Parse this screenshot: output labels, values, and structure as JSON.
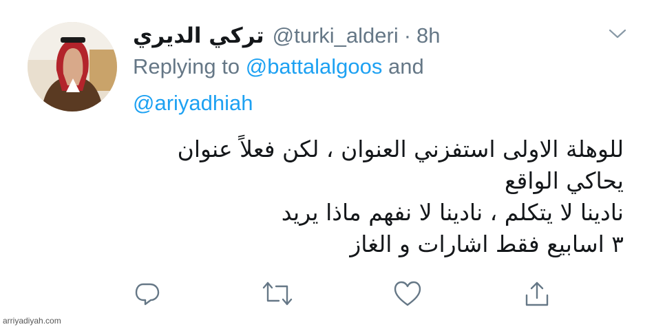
{
  "tweet": {
    "display_name": "تركي الديري",
    "handle": "@turki_alderi",
    "separator": "·",
    "time": "8h",
    "replying": {
      "prefix": "Replying to",
      "mention_1": "@battalalgoos",
      "joiner": "and",
      "mention_2": "@ariyadhiah"
    },
    "body_lines": [
      "للوهلة الاولى استفزني العنوان ، لكن فعلاً عنوان",
      "يحاكي الواقع",
      "نادينا لا يتكلم ، نادينا لا نفهم ماذا يريد",
      "٣ اسابيع فقط اشارات و الغاز"
    ]
  },
  "actions": {
    "icons": [
      "reply-icon",
      "retweet-icon",
      "like-icon",
      "share-icon"
    ]
  },
  "watermark": "arriyadiyah.com",
  "colors": {
    "text_primary": "#14171a",
    "text_secondary": "#657786",
    "link": "#1da1f2",
    "icon": "#657786"
  }
}
